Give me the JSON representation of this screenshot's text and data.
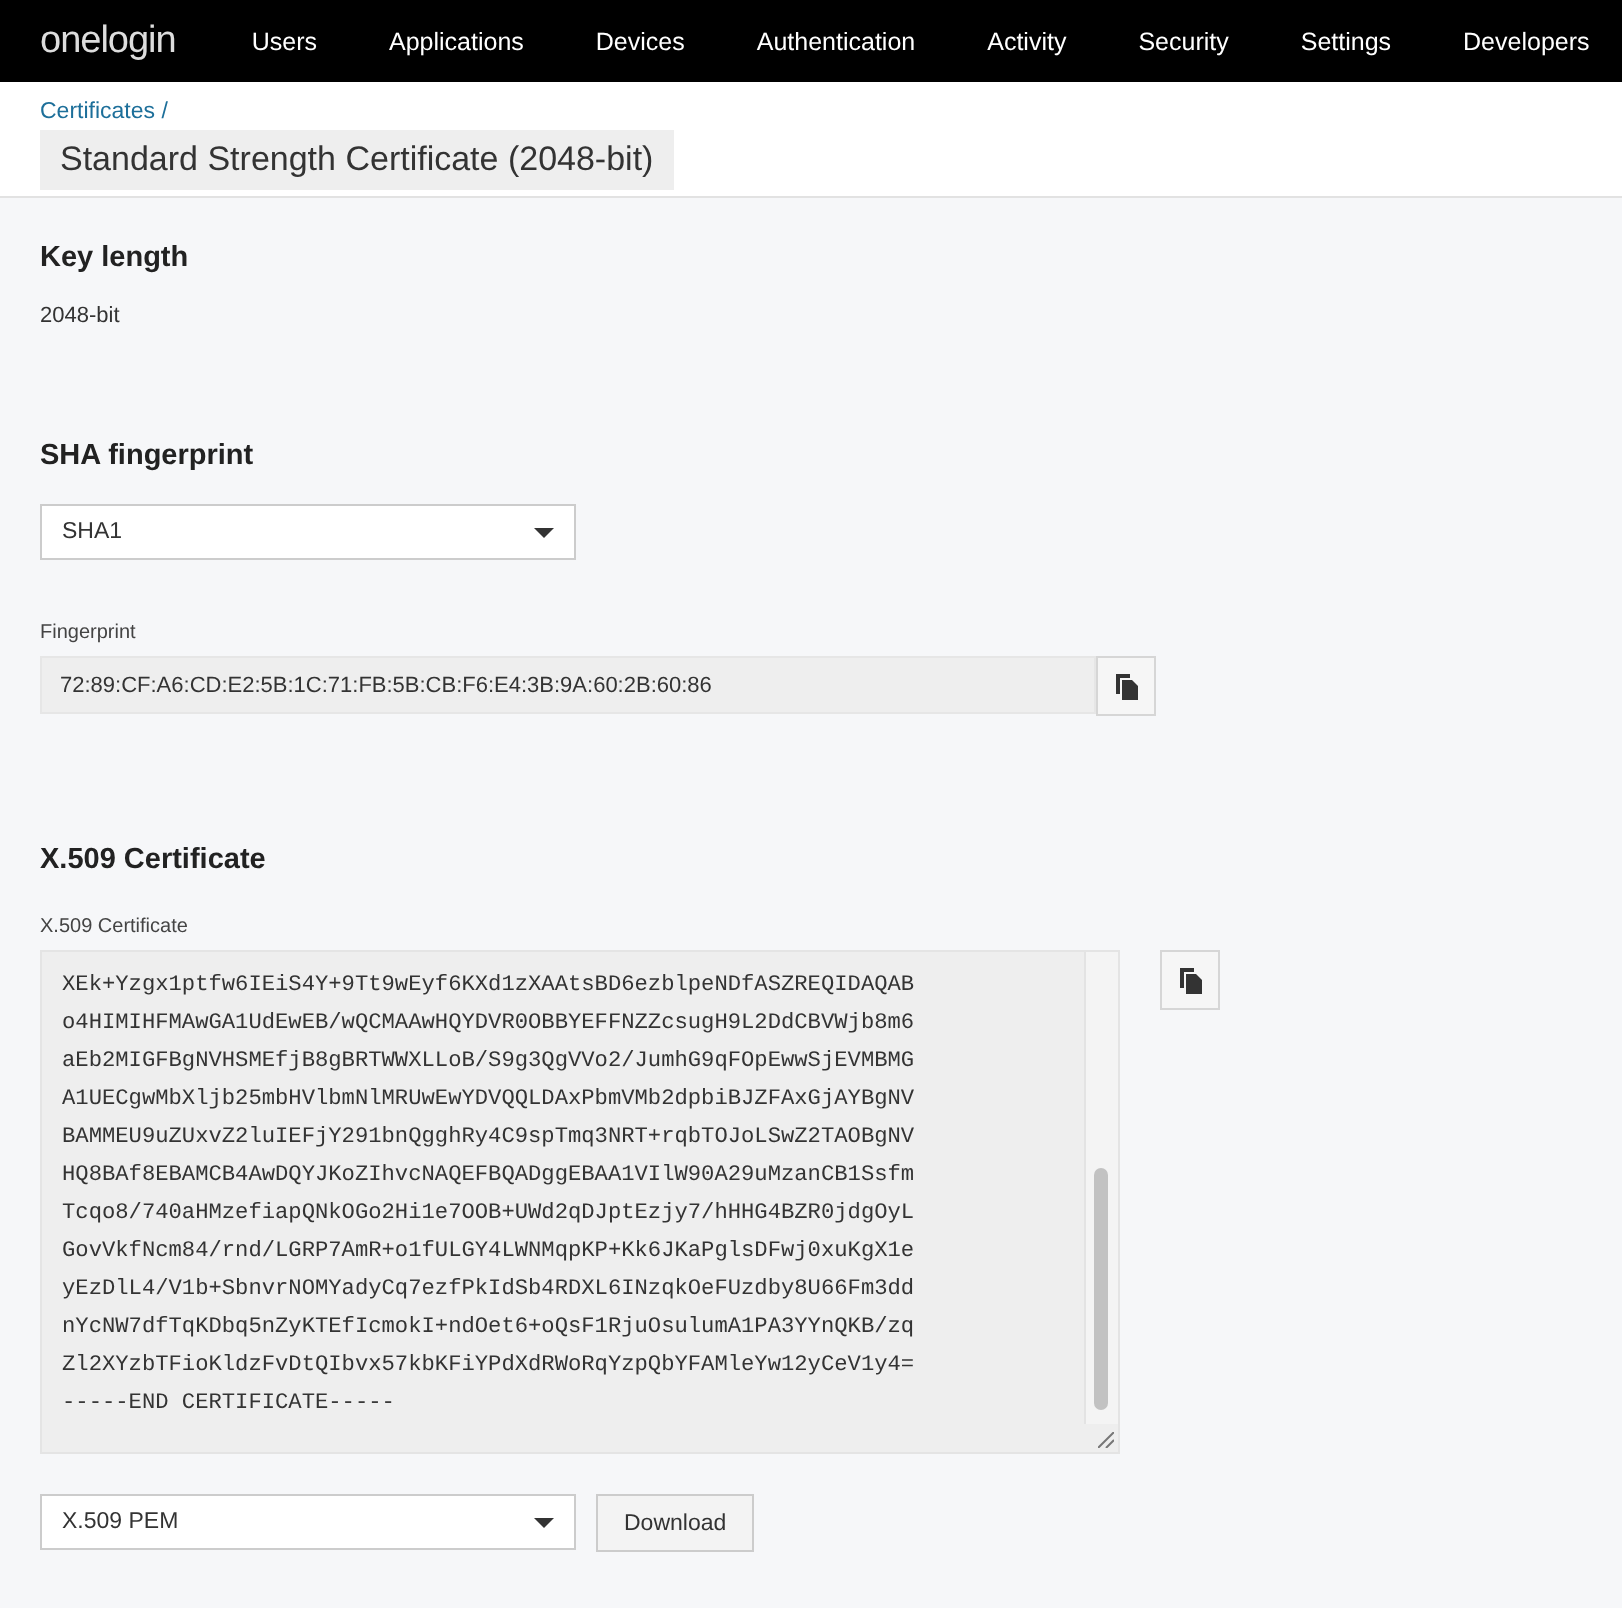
{
  "nav": {
    "logo": "onelogin",
    "items": [
      "Users",
      "Applications",
      "Devices",
      "Authentication",
      "Activity",
      "Security",
      "Settings",
      "Developers"
    ]
  },
  "breadcrumb": "Certificates /",
  "title": "Standard Strength Certificate (2048-bit)",
  "key_length": {
    "heading": "Key length",
    "value": "2048-bit"
  },
  "sha": {
    "heading": "SHA fingerprint",
    "select": "SHA1",
    "label": "Fingerprint",
    "value": "72:89:CF:A6:CD:E2:5B:1C:71:FB:5B:CB:F6:E4:3B:9A:60:2B:60:86"
  },
  "x509": {
    "heading": "X.509 Certificate",
    "label": "X.509 Certificate",
    "lines": [
      "XEk+Yzgx1ptfw6IEiS4Y+9Tt9wEyf6KXd1zXAAtsBD6ezblpeNDfASZREQIDAQAB",
      "o4HIMIHFMAwGA1UdEwEB/wQCMAAwHQYDVR0OBBYEFFNZZcsugH9L2DdCBVWjb8m6",
      "aEb2MIGFBgNVHSMEfjB8gBRTWWXLLoB/S9g3QgVVo2/JumhG9qFOpEwwSjEVMBMG",
      "A1UECgwMbXljb25mbHVlbmNlMRUwEwYDVQQLDAxPbmVMb2dpbiBJZFAxGjAYBgNV",
      "BAMMEU9uZUxvZ2luIEFjY291bnQgghRy4C9spTmq3NRT+rqbTOJoLSwZ2TAOBgNV",
      "HQ8BAf8EBAMCB4AwDQYJKoZIhvcNAQEFBQADggEBAA1VIlW90A29uMzanCB1Ssfm",
      "Tcqo8/740aHMzefiapQNkOGo2Hi1e7OOB+UWd2qDJptEzjy7/hHHG4BZR0jdgOyL",
      "GovVkfNcm84/rnd/LGRP7AmR+o1fULGY4LWNMqpKP+Kk6JKaPglsDFwj0xuKgX1e",
      "yEzDlL4/V1b+SbnvrNOMYadyCq7ezfPkIdSb4RDXL6INzqkOeFUzdby8U66Fm3dd",
      "nYcNW7dfTqKDbq5nZyKTEfIcmokI+ndOet6+oQsF1RjuOsulumA1PA3YYnQKB/zq",
      "Zl2XYzbTFioKldzFvDtQIbvx57kbKFiYPdXdRWoRqYzpQbYFAMleYw12yCeV1y4=",
      "-----END CERTIFICATE-----"
    ],
    "format": "X.509 PEM",
    "download": "Download"
  }
}
